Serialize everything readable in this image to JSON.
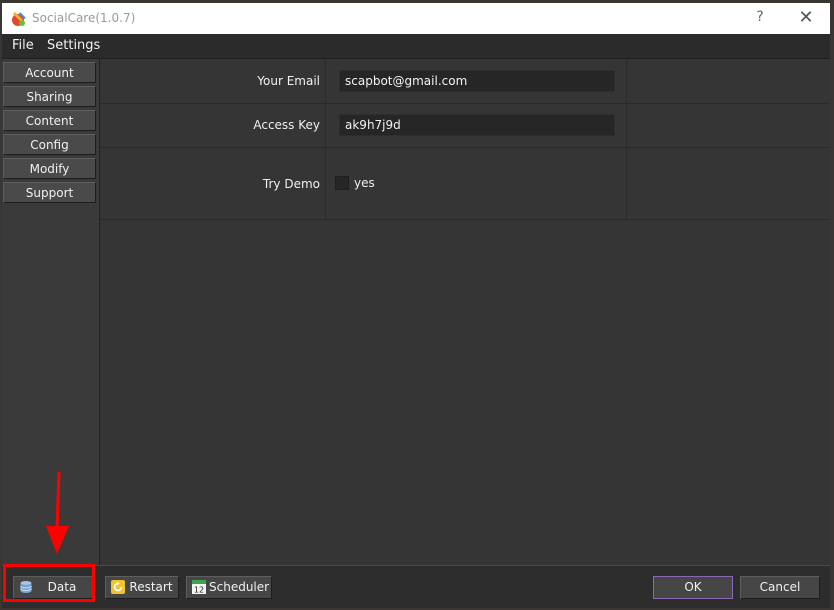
{
  "window": {
    "title": "SocialCare(1.0.7)",
    "help_glyph": "?",
    "close_glyph": "✕"
  },
  "menubar": {
    "items": [
      "File",
      "Settings"
    ]
  },
  "sidebar": {
    "items": [
      "Account",
      "Sharing",
      "Content",
      "Config",
      "Modify",
      "Support"
    ]
  },
  "form": {
    "email_label": "Your Email",
    "email_value": "scapbot@gmail.com",
    "access_key_label": "Access Key",
    "access_key_value": "ak9h7j9d",
    "try_demo_label": "Try Demo",
    "try_demo_option": "yes",
    "try_demo_checked": false
  },
  "footer": {
    "data_label": "Data",
    "restart_label": "Restart",
    "scheduler_label": "Scheduler",
    "scheduler_icon_number": "12",
    "ok_label": "OK",
    "cancel_label": "Cancel"
  },
  "icons": {
    "app": "app-logo-icon",
    "data": "database-icon",
    "restart": "restart-icon",
    "scheduler": "calendar-icon"
  },
  "colors": {
    "accent": "#8a66b5",
    "annotation": "#ff0000"
  }
}
